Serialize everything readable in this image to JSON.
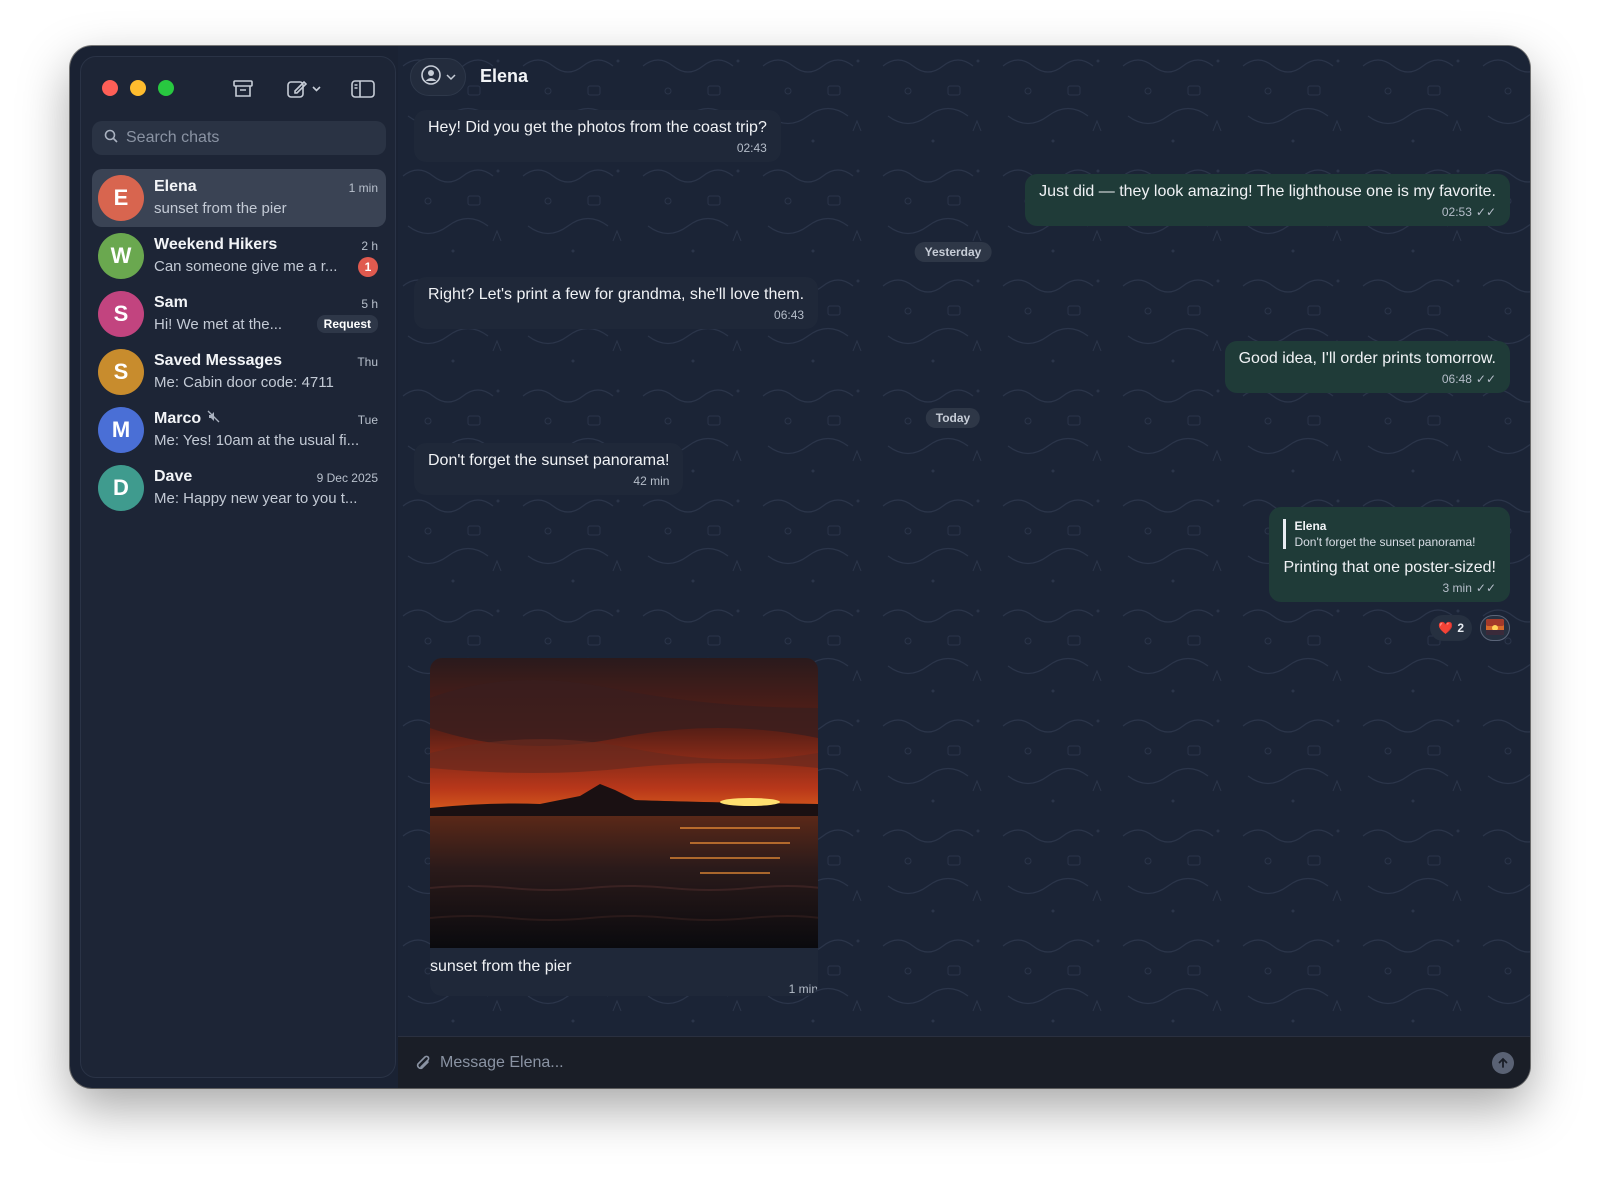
{
  "sidebar": {
    "search_placeholder": "Search chats",
    "chats": [
      {
        "initial": "E",
        "name": "Elena",
        "time": "1 min",
        "preview": "sunset from the pier",
        "color": "#d8654f",
        "active": true
      },
      {
        "initial": "W",
        "name": "Weekend Hikers",
        "time": "2 h",
        "preview": "Can someone give me a r...",
        "color": "#6aa84f",
        "unread": "1"
      },
      {
        "initial": "S",
        "name": "Sam",
        "time": "5 h",
        "preview": "Hi! We met at the...",
        "color": "#c2447f",
        "tag": "Request"
      },
      {
        "initial": "S",
        "name": "Saved Messages",
        "time": "Thu",
        "preview": "Me: Cabin door code: 4711",
        "color": "#c88c2d"
      },
      {
        "initial": "M",
        "name": "Marco",
        "time": "Tue",
        "preview": "Me: Yes! 10am at the usual fi...",
        "color": "#4a6fd6",
        "muted": true
      },
      {
        "initial": "D",
        "name": "Dave",
        "time": "9 Dec 2025",
        "preview": "Me: Happy new year to you t...",
        "color": "#3f9b8e"
      }
    ]
  },
  "header": {
    "title": "Elena"
  },
  "messages": {
    "m1": {
      "text": "Hey! Did you get the photos from the coast trip?",
      "time": "02:43"
    },
    "m2": {
      "text": "Just did — they look amazing! The lighthouse one is my favorite.",
      "time": "02:53",
      "status": "✓✓"
    },
    "date_yesterday": "Yesterday",
    "m3": {
      "text": "Right? Let's print a few for grandma, she'll love them.",
      "time": "06:43"
    },
    "m4": {
      "text": "Good idea, I'll order prints tomorrow.",
      "time": "06:48",
      "status": "✓✓"
    },
    "date_today": "Today",
    "m5": {
      "text": "Don't forget the sunset panorama!",
      "time": "42 min"
    },
    "m6": {
      "reply_name": "Elena",
      "reply_text": "Don't forget the sunset panorama!",
      "text": "Printing that one poster-sized!",
      "time": "3 min",
      "status": "✓✓",
      "reaction_emoji": "❤️",
      "reaction_count": "2"
    },
    "m7": {
      "caption": "sunset from the pier",
      "time": "1 min"
    }
  },
  "composer": {
    "placeholder": "Message Elena..."
  },
  "colors": {
    "accent_out": "#1f3b38",
    "bubble_in": "#1f2839",
    "background": "#1b2436"
  }
}
